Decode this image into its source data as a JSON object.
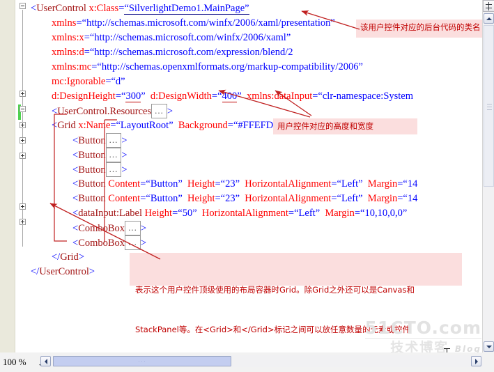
{
  "editor": {
    "zoom_level": "100 %",
    "code_lines": [
      {
        "indent": 0,
        "segments": [
          {
            "t": "<",
            "c": "punct"
          },
          {
            "t": "UserControl",
            "c": "tag"
          },
          {
            "t": " ",
            "c": "plain"
          },
          {
            "t": "x:Class",
            "c": "attr"
          },
          {
            "t": "=",
            "c": "punct"
          },
          {
            "t": "“SilverlightDemo1.MainPage”",
            "c": "val",
            "u": "blue"
          }
        ]
      },
      {
        "indent": 1,
        "segments": [
          {
            "t": "xmlns",
            "c": "attr"
          },
          {
            "t": "=",
            "c": "punct"
          },
          {
            "t": "“http://schemas.microsoft.com/winfx/2006/xaml/presentation”",
            "c": "val"
          }
        ]
      },
      {
        "indent": 1,
        "segments": [
          {
            "t": "xmlns:x",
            "c": "attr"
          },
          {
            "t": "=",
            "c": "punct"
          },
          {
            "t": "“http://schemas.microsoft.com/winfx/2006/xaml”",
            "c": "val"
          }
        ]
      },
      {
        "indent": 1,
        "segments": [
          {
            "t": "xmlns:d",
            "c": "attr"
          },
          {
            "t": "=",
            "c": "punct"
          },
          {
            "t": "“http://schemas.microsoft.com/expression/blend/2",
            "c": "val"
          }
        ]
      },
      {
        "indent": 1,
        "segments": [
          {
            "t": "xmlns:mc",
            "c": "attr"
          },
          {
            "t": "=",
            "c": "punct"
          },
          {
            "t": "“http://schemas.openxmlformats.org/markup-compatibility/2006”",
            "c": "val"
          }
        ]
      },
      {
        "indent": 1,
        "segments": [
          {
            "t": "mc:Ignorable",
            "c": "attr"
          },
          {
            "t": "=",
            "c": "punct"
          },
          {
            "t": "“d”",
            "c": "val"
          }
        ]
      },
      {
        "indent": 1,
        "segments": [
          {
            "t": "d:DesignHeight",
            "c": "attr"
          },
          {
            "t": "=",
            "c": "punct"
          },
          {
            "t": "“",
            "c": "val"
          },
          {
            "t": "300",
            "c": "val",
            "u": "red"
          },
          {
            "t": "”",
            "c": "val"
          },
          {
            "t": "  ",
            "c": "plain"
          },
          {
            "t": "d:DesignWidth",
            "c": "attr"
          },
          {
            "t": "=",
            "c": "punct"
          },
          {
            "t": "“",
            "c": "val"
          },
          {
            "t": "400",
            "c": "val",
            "u": "red"
          },
          {
            "t": "”",
            "c": "val"
          },
          {
            "t": "  ",
            "c": "plain"
          },
          {
            "t": "xmlns:dataInput",
            "c": "attr"
          },
          {
            "t": "=",
            "c": "punct"
          },
          {
            "t": "“clr-namespace:System",
            "c": "val"
          }
        ]
      },
      {
        "indent": 1,
        "segments": [
          {
            "t": "<",
            "c": "punct"
          },
          {
            "t": "UserControl.Resources",
            "c": "tag"
          },
          {
            "t": "…",
            "c": "ellipsis"
          },
          {
            "t": ">",
            "c": "punct"
          }
        ]
      },
      {
        "indent": 1,
        "segments": [
          {
            "t": "<",
            "c": "punct"
          },
          {
            "t": "Grid",
            "c": "tag"
          },
          {
            "t": " ",
            "c": "plain"
          },
          {
            "t": "x:Name",
            "c": "attr"
          },
          {
            "t": "=",
            "c": "punct"
          },
          {
            "t": "“LayoutRoot”",
            "c": "val"
          },
          {
            "t": "  ",
            "c": "plain"
          },
          {
            "t": "Background",
            "c": "attr"
          },
          {
            "t": "=",
            "c": "punct"
          },
          {
            "t": "“#FFEFDFDF”",
            "c": "val"
          },
          {
            "t": ">",
            "c": "punct"
          }
        ]
      },
      {
        "indent": 2,
        "segments": [
          {
            "t": "<",
            "c": "punct"
          },
          {
            "t": "Button",
            "c": "tag"
          },
          {
            "t": "…",
            "c": "ellipsis"
          },
          {
            "t": ">",
            "c": "punct"
          }
        ]
      },
      {
        "indent": 2,
        "segments": [
          {
            "t": "<",
            "c": "punct"
          },
          {
            "t": "Button",
            "c": "tag"
          },
          {
            "t": "…",
            "c": "ellipsis"
          },
          {
            "t": ">",
            "c": "punct"
          }
        ]
      },
      {
        "indent": 2,
        "segments": [
          {
            "t": "<",
            "c": "punct"
          },
          {
            "t": "Button",
            "c": "tag"
          },
          {
            "t": "…",
            "c": "ellipsis"
          },
          {
            "t": ">",
            "c": "punct"
          }
        ]
      },
      {
        "indent": 2,
        "segments": [
          {
            "t": "<",
            "c": "punct"
          },
          {
            "t": "Button",
            "c": "tag"
          },
          {
            "t": " ",
            "c": "plain"
          },
          {
            "t": "Content",
            "c": "attr"
          },
          {
            "t": "=",
            "c": "punct"
          },
          {
            "t": "“Button”",
            "c": "val"
          },
          {
            "t": "  ",
            "c": "plain"
          },
          {
            "t": "Height",
            "c": "attr"
          },
          {
            "t": "=",
            "c": "punct"
          },
          {
            "t": "“23”",
            "c": "val"
          },
          {
            "t": "  ",
            "c": "plain"
          },
          {
            "t": "HorizontalAlignment",
            "c": "attr"
          },
          {
            "t": "=",
            "c": "punct"
          },
          {
            "t": "“Left”",
            "c": "val"
          },
          {
            "t": "  ",
            "c": "plain"
          },
          {
            "t": "Margin",
            "c": "attr"
          },
          {
            "t": "=",
            "c": "punct"
          },
          {
            "t": "“14",
            "c": "val"
          }
        ]
      },
      {
        "indent": 2,
        "segments": [
          {
            "t": "<",
            "c": "punct"
          },
          {
            "t": "Button",
            "c": "tag"
          },
          {
            "t": " ",
            "c": "plain"
          },
          {
            "t": "Content",
            "c": "attr"
          },
          {
            "t": "=",
            "c": "punct"
          },
          {
            "t": "“Button”",
            "c": "val"
          },
          {
            "t": "  ",
            "c": "plain"
          },
          {
            "t": "Height",
            "c": "attr"
          },
          {
            "t": "=",
            "c": "punct"
          },
          {
            "t": "“23”",
            "c": "val"
          },
          {
            "t": "  ",
            "c": "plain"
          },
          {
            "t": "HorizontalAlignment",
            "c": "attr"
          },
          {
            "t": "=",
            "c": "punct"
          },
          {
            "t": "“Left”",
            "c": "val"
          },
          {
            "t": "  ",
            "c": "plain"
          },
          {
            "t": "Margin",
            "c": "attr"
          },
          {
            "t": "=",
            "c": "punct"
          },
          {
            "t": "“14",
            "c": "val"
          }
        ]
      },
      {
        "indent": 2,
        "segments": [
          {
            "t": "<",
            "c": "punct"
          },
          {
            "t": "dataInput:Label",
            "c": "tag"
          },
          {
            "t": " ",
            "c": "plain"
          },
          {
            "t": "Height",
            "c": "attr"
          },
          {
            "t": "=",
            "c": "punct"
          },
          {
            "t": "“50”",
            "c": "val"
          },
          {
            "t": "  ",
            "c": "plain"
          },
          {
            "t": "HorizontalAlignment",
            "c": "attr"
          },
          {
            "t": "=",
            "c": "punct"
          },
          {
            "t": "“Left”",
            "c": "val"
          },
          {
            "t": "  ",
            "c": "plain"
          },
          {
            "t": "Margin",
            "c": "attr"
          },
          {
            "t": "=",
            "c": "punct"
          },
          {
            "t": "“10,10,0,0”",
            "c": "val"
          }
        ]
      },
      {
        "indent": 2,
        "segments": [
          {
            "t": "<",
            "c": "punct"
          },
          {
            "t": "ComboBox",
            "c": "tag"
          },
          {
            "t": "…",
            "c": "ellipsis"
          },
          {
            "t": ">",
            "c": "punct"
          }
        ]
      },
      {
        "indent": 2,
        "segments": [
          {
            "t": "<",
            "c": "punct"
          },
          {
            "t": "ComboBox",
            "c": "tag"
          },
          {
            "t": "…",
            "c": "ellipsis"
          },
          {
            "t": ">",
            "c": "punct"
          }
        ]
      },
      {
        "indent": 1,
        "segments": [
          {
            "t": "</",
            "c": "punct"
          },
          {
            "t": "Grid",
            "c": "tag"
          },
          {
            "t": ">",
            "c": "punct"
          }
        ]
      },
      {
        "indent": 0,
        "segments": [
          {
            "t": "</",
            "c": "punct"
          },
          {
            "t": "UserControl",
            "c": "tag"
          },
          {
            "t": ">",
            "c": "punct"
          }
        ]
      }
    ]
  },
  "annotations": [
    {
      "id": "class-name-note",
      "text": "该用户控件对应的后台代码的类名"
    },
    {
      "id": "size-note",
      "text": "用户控件对应的高度和宽度"
    },
    {
      "id": "grid-note",
      "line1": "表示这个用户控件顶级使用的布局容器时Grid。除Grid之外还可以是Canvas和",
      "line2": "StackPanel等。在<Grid>和</Grid>标记之间可以放任意数量的元素或控件"
    }
  ],
  "watermark": {
    "line1": "51CTO.com",
    "line2": "技术博客",
    "blog": "Blog"
  },
  "colors": {
    "annotation_bg": "#fbdede",
    "annotation_text": "#c00000",
    "tag": "#a31515",
    "attribute": "#ff0000",
    "value": "#0000ff",
    "gutter": "#eae9dc",
    "change_bar": "#4fd24f"
  }
}
